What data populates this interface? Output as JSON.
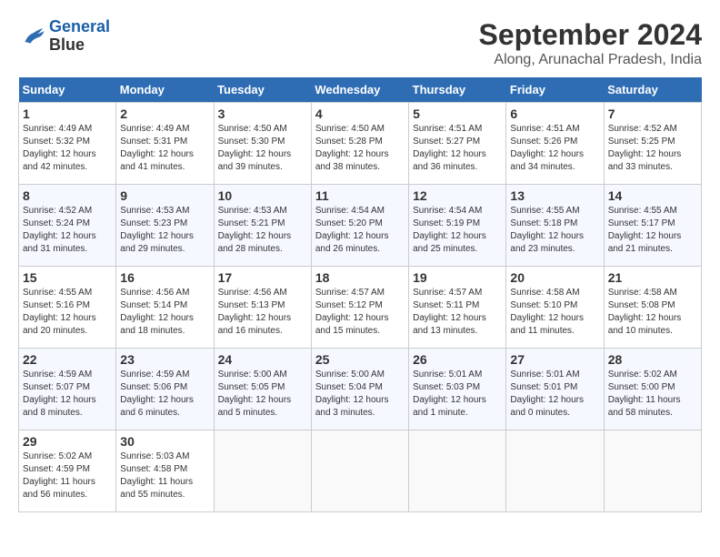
{
  "app": {
    "logo_line1": "General",
    "logo_line2": "Blue"
  },
  "title": "September 2024",
  "subtitle": "Along, Arunachal Pradesh, India",
  "days_of_week": [
    "Sunday",
    "Monday",
    "Tuesday",
    "Wednesday",
    "Thursday",
    "Friday",
    "Saturday"
  ],
  "weeks": [
    [
      {
        "day": 1,
        "info": "Sunrise: 4:49 AM\nSunset: 5:32 PM\nDaylight: 12 hours\nand 42 minutes."
      },
      {
        "day": 2,
        "info": "Sunrise: 4:49 AM\nSunset: 5:31 PM\nDaylight: 12 hours\nand 41 minutes."
      },
      {
        "day": 3,
        "info": "Sunrise: 4:50 AM\nSunset: 5:30 PM\nDaylight: 12 hours\nand 39 minutes."
      },
      {
        "day": 4,
        "info": "Sunrise: 4:50 AM\nSunset: 5:28 PM\nDaylight: 12 hours\nand 38 minutes."
      },
      {
        "day": 5,
        "info": "Sunrise: 4:51 AM\nSunset: 5:27 PM\nDaylight: 12 hours\nand 36 minutes."
      },
      {
        "day": 6,
        "info": "Sunrise: 4:51 AM\nSunset: 5:26 PM\nDaylight: 12 hours\nand 34 minutes."
      },
      {
        "day": 7,
        "info": "Sunrise: 4:52 AM\nSunset: 5:25 PM\nDaylight: 12 hours\nand 33 minutes."
      }
    ],
    [
      {
        "day": 8,
        "info": "Sunrise: 4:52 AM\nSunset: 5:24 PM\nDaylight: 12 hours\nand 31 minutes."
      },
      {
        "day": 9,
        "info": "Sunrise: 4:53 AM\nSunset: 5:23 PM\nDaylight: 12 hours\nand 29 minutes."
      },
      {
        "day": 10,
        "info": "Sunrise: 4:53 AM\nSunset: 5:21 PM\nDaylight: 12 hours\nand 28 minutes."
      },
      {
        "day": 11,
        "info": "Sunrise: 4:54 AM\nSunset: 5:20 PM\nDaylight: 12 hours\nand 26 minutes."
      },
      {
        "day": 12,
        "info": "Sunrise: 4:54 AM\nSunset: 5:19 PM\nDaylight: 12 hours\nand 25 minutes."
      },
      {
        "day": 13,
        "info": "Sunrise: 4:55 AM\nSunset: 5:18 PM\nDaylight: 12 hours\nand 23 minutes."
      },
      {
        "day": 14,
        "info": "Sunrise: 4:55 AM\nSunset: 5:17 PM\nDaylight: 12 hours\nand 21 minutes."
      }
    ],
    [
      {
        "day": 15,
        "info": "Sunrise: 4:55 AM\nSunset: 5:16 PM\nDaylight: 12 hours\nand 20 minutes."
      },
      {
        "day": 16,
        "info": "Sunrise: 4:56 AM\nSunset: 5:14 PM\nDaylight: 12 hours\nand 18 minutes."
      },
      {
        "day": 17,
        "info": "Sunrise: 4:56 AM\nSunset: 5:13 PM\nDaylight: 12 hours\nand 16 minutes."
      },
      {
        "day": 18,
        "info": "Sunrise: 4:57 AM\nSunset: 5:12 PM\nDaylight: 12 hours\nand 15 minutes."
      },
      {
        "day": 19,
        "info": "Sunrise: 4:57 AM\nSunset: 5:11 PM\nDaylight: 12 hours\nand 13 minutes."
      },
      {
        "day": 20,
        "info": "Sunrise: 4:58 AM\nSunset: 5:10 PM\nDaylight: 12 hours\nand 11 minutes."
      },
      {
        "day": 21,
        "info": "Sunrise: 4:58 AM\nSunset: 5:08 PM\nDaylight: 12 hours\nand 10 minutes."
      }
    ],
    [
      {
        "day": 22,
        "info": "Sunrise: 4:59 AM\nSunset: 5:07 PM\nDaylight: 12 hours\nand 8 minutes."
      },
      {
        "day": 23,
        "info": "Sunrise: 4:59 AM\nSunset: 5:06 PM\nDaylight: 12 hours\nand 6 minutes."
      },
      {
        "day": 24,
        "info": "Sunrise: 5:00 AM\nSunset: 5:05 PM\nDaylight: 12 hours\nand 5 minutes."
      },
      {
        "day": 25,
        "info": "Sunrise: 5:00 AM\nSunset: 5:04 PM\nDaylight: 12 hours\nand 3 minutes."
      },
      {
        "day": 26,
        "info": "Sunrise: 5:01 AM\nSunset: 5:03 PM\nDaylight: 12 hours\nand 1 minute."
      },
      {
        "day": 27,
        "info": "Sunrise: 5:01 AM\nSunset: 5:01 PM\nDaylight: 12 hours\nand 0 minutes."
      },
      {
        "day": 28,
        "info": "Sunrise: 5:02 AM\nSunset: 5:00 PM\nDaylight: 11 hours\nand 58 minutes."
      }
    ],
    [
      {
        "day": 29,
        "info": "Sunrise: 5:02 AM\nSunset: 4:59 PM\nDaylight: 11 hours\nand 56 minutes."
      },
      {
        "day": 30,
        "info": "Sunrise: 5:03 AM\nSunset: 4:58 PM\nDaylight: 11 hours\nand 55 minutes."
      },
      null,
      null,
      null,
      null,
      null
    ]
  ]
}
